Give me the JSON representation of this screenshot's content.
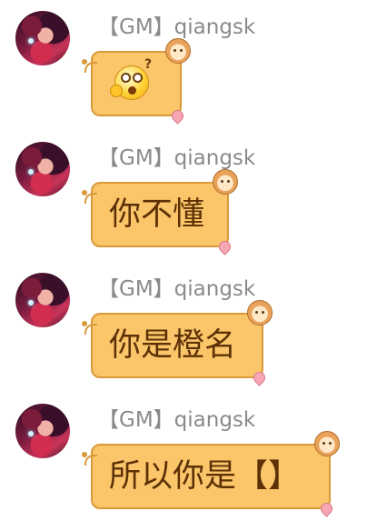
{
  "messages": [
    {
      "sender": "【GM】qiangsk",
      "content_type": "emoji",
      "emoji": "confused-face-emoji",
      "text": ""
    },
    {
      "sender": "【GM】qiangsk",
      "content_type": "text",
      "text": "你不懂"
    },
    {
      "sender": "【GM】qiangsk",
      "content_type": "text",
      "text": "你是橙名"
    },
    {
      "sender": "【GM】qiangsk",
      "content_type": "text",
      "text": "所以你是【】"
    }
  ],
  "colors": {
    "bubble_fill": "#fbc56a",
    "bubble_border": "#d99a3a",
    "message_text": "#5c3106",
    "sender_text": "#8a8a8a"
  }
}
